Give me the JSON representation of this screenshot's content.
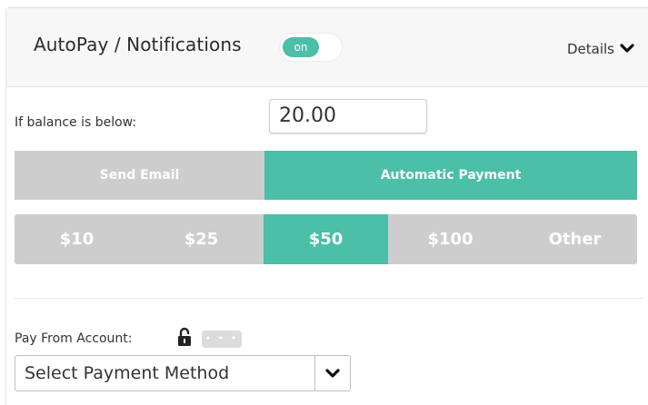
{
  "header": {
    "title": "AutoPay / Notifications",
    "toggle_label": "on",
    "details_label": "Details",
    "details_icon": "chevron-down-icon"
  },
  "balance": {
    "label": "If balance is below:",
    "value": "20.00"
  },
  "mode_options": [
    {
      "label": "Send Email",
      "selected": false
    },
    {
      "label": "Automatic Payment",
      "selected": true
    }
  ],
  "amount_options": [
    {
      "label": "$10",
      "selected": false
    },
    {
      "label": "$25",
      "selected": false
    },
    {
      "label": "$50",
      "selected": true
    },
    {
      "label": "$100",
      "selected": false
    },
    {
      "label": "Other",
      "selected": false
    }
  ],
  "payment": {
    "label": "Pay From Account:",
    "lock_icon": "unlock-icon",
    "more_label": "• • •",
    "select_value": "Select Payment Method",
    "select_icon": "chevron-down-icon"
  },
  "colors": {
    "accent": "#4bbfa7",
    "inactive": "#cdcdcd"
  }
}
